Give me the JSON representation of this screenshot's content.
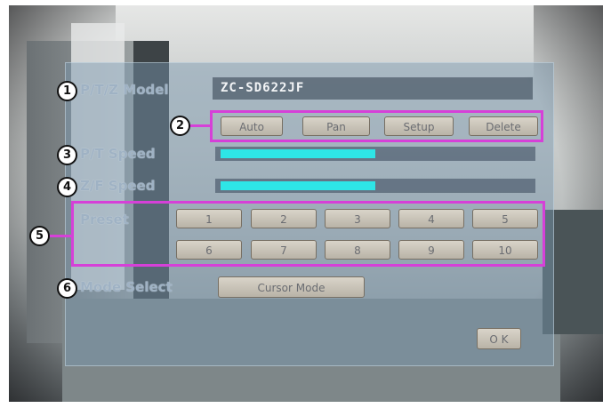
{
  "osd": {
    "ptz_model": {
      "label": "P/T/Z Model",
      "value": "ZC-SD622JF"
    },
    "pt_speed": {
      "label": "P/T Speed",
      "level": 0.5
    },
    "z_speed": {
      "label": "Z/F Speed",
      "level": 0.5
    },
    "preset": {
      "label": "Preset",
      "buttons": [
        "1",
        "2",
        "3",
        "4",
        "5",
        "6",
        "7",
        "8",
        "9",
        "10"
      ]
    },
    "mode_select": {
      "label": "Mode Select",
      "button": "Cursor Mode"
    },
    "ok_button": "O K"
  },
  "actions": [
    "Auto",
    "Pan",
    "Setup",
    "Delete"
  ],
  "callouts": [
    "1",
    "2",
    "3",
    "4",
    "5",
    "6"
  ],
  "colors": {
    "highlight": "#d640d8",
    "speed_bar": "#2ee6e6",
    "button_face": "#d9d4c9"
  }
}
